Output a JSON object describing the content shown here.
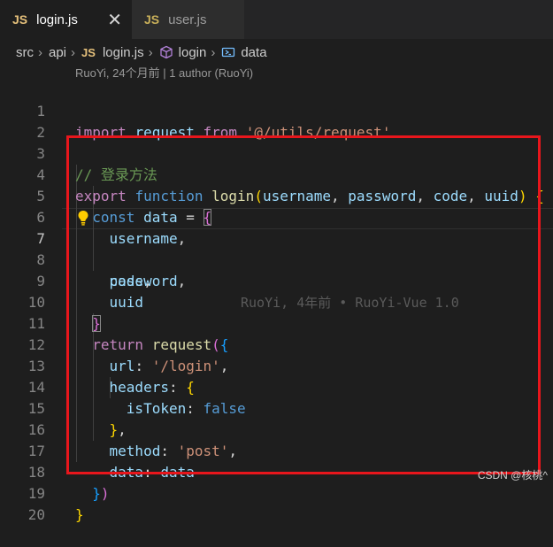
{
  "tabs": [
    {
      "badge": "JS",
      "label": "login.js",
      "active": true
    },
    {
      "badge": "JS",
      "label": "user.js",
      "active": false
    }
  ],
  "tab_close": "✕",
  "breadcrumb": {
    "segments": [
      "src",
      "api",
      "login.js",
      "login",
      "data"
    ],
    "file_badge": "JS",
    "separator": "›"
  },
  "codelens": "RuoYi, 24个月前 | 1 author (RuoYi)",
  "line_numbers": [
    "1",
    "2",
    "3",
    "4",
    "5",
    "6",
    "7",
    "8",
    "9",
    "10",
    "11",
    "12",
    "13",
    "14",
    "15",
    "16",
    "17",
    "18",
    "19",
    "20"
  ],
  "current_line": "7",
  "blame": "RuoYi, 4年前 • RuoYi-Vue 1.0",
  "code": {
    "l1": [
      "import",
      "request",
      "from",
      "'@/utils/request'"
    ],
    "l3": "// 登录方法",
    "l4": [
      "export",
      "function",
      "login",
      "(",
      "username",
      ", ",
      "password",
      ", ",
      "code",
      ", ",
      "uuid",
      ")",
      " {"
    ],
    "l5": [
      "const",
      "data",
      " = ",
      "{"
    ],
    "l6": [
      "username",
      ","
    ],
    "l7": [
      "password",
      ","
    ],
    "l8": [
      "code",
      ","
    ],
    "l9": [
      "uuid"
    ],
    "l10": [
      "}"
    ],
    "l11": [
      "return",
      "request",
      "(",
      "{"
    ],
    "l12": [
      "url",
      ": ",
      "'/login'",
      ","
    ],
    "l13": [
      "headers",
      ": ",
      "{"
    ],
    "l14": [
      "isToken",
      ": ",
      "false"
    ],
    "l15": [
      "}",
      ","
    ],
    "l16": [
      "method",
      ": ",
      "'post'",
      ","
    ],
    "l17": [
      "data",
      ": ",
      "data"
    ],
    "l18": [
      "}",
      ")"
    ],
    "l19": [
      "}"
    ]
  },
  "watermark": "CSDN @核桃^",
  "colors": {
    "highlight_border": "#e8161c",
    "keyword": "#569cd6",
    "control": "#c586c0",
    "function": "#dcdcaa",
    "string": "#ce9178",
    "variable": "#9cdcfe"
  }
}
